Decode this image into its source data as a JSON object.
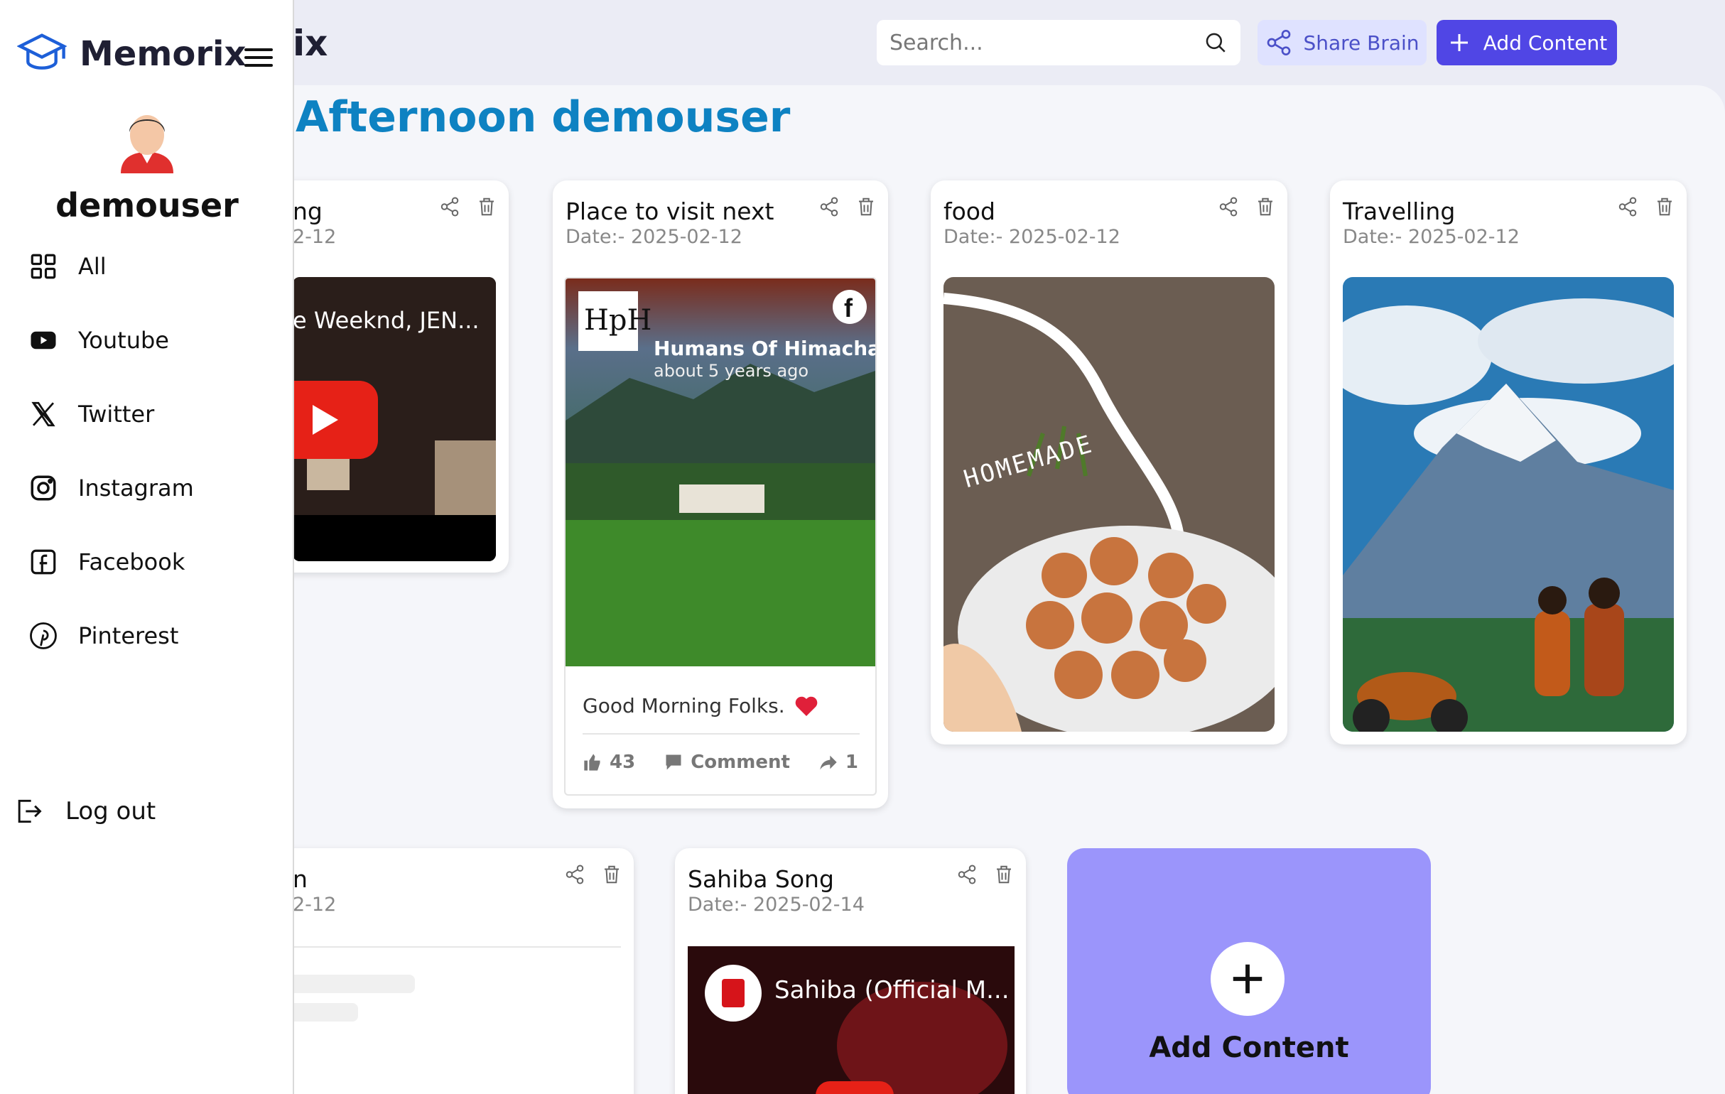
{
  "app": {
    "name": "Memorix",
    "name_partial": "ix"
  },
  "header": {
    "search_placeholder": "Search...",
    "share_label": "Share Brain",
    "add_label": "Add Content"
  },
  "greeting": "Afternoon demouser",
  "sidebar": {
    "username": "demouser",
    "items": [
      {
        "label": "All",
        "icon": "grid-icon"
      },
      {
        "label": "Youtube",
        "icon": "youtube-icon"
      },
      {
        "label": "Twitter",
        "icon": "x-twitter-icon"
      },
      {
        "label": "Instagram",
        "icon": "instagram-icon"
      },
      {
        "label": "Facebook",
        "icon": "facebook-icon"
      },
      {
        "label": "Pinterest",
        "icon": "pinterest-icon"
      }
    ],
    "logout": "Log out"
  },
  "cards": [
    {
      "title": "ng",
      "date": "2-12",
      "type": "youtube",
      "video_title": "e Weeknd, JEN..."
    },
    {
      "title": "Place to visit next",
      "date": "Date:- 2025-02-12",
      "type": "facebook",
      "page_name": "Humans Of Himachal",
      "page_time": "about 5 years ago",
      "post_text": "Good Morning Folks.",
      "likes": "43",
      "comment_label": "Comment",
      "shares": "1"
    },
    {
      "title": "food",
      "date": "Date:- 2025-02-12",
      "type": "image",
      "image_text": "HOMEMADE"
    },
    {
      "title": "Travelling",
      "date": "Date:- 2025-02-12",
      "type": "image"
    },
    {
      "title": "n",
      "date": "2-12",
      "type": "loading"
    },
    {
      "title": "Sahiba Song",
      "date": "Date:- 2025-02-14",
      "type": "youtube",
      "video_title": "Sahiba (Official M..."
    }
  ],
  "add_card": {
    "label": "Add Content"
  },
  "colors": {
    "accent": "#5046e5",
    "greeting": "#0e82c2",
    "add_card": "#9b95fb"
  }
}
